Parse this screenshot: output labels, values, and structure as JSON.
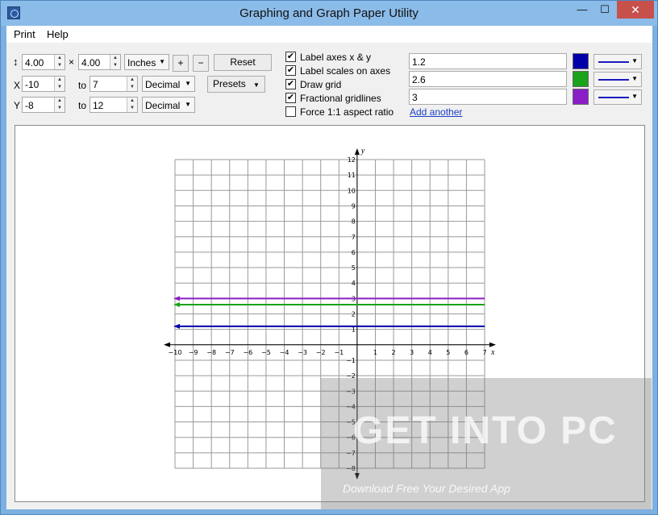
{
  "window": {
    "title": "Graphing and Graph Paper Utility",
    "min_glyph": "—",
    "max_glyph": "☐",
    "close_glyph": "✕"
  },
  "menu": {
    "print": "Print",
    "help": "Help"
  },
  "size": {
    "height_icon_glyph": "↕",
    "width": "4.00",
    "times": "×",
    "height": "4.00",
    "unit": "Inches",
    "plus": "+",
    "minus": "−",
    "reset": "Reset"
  },
  "x_range": {
    "label": "X",
    "from": "-10",
    "to_label": "to",
    "to": "7",
    "format": "Decimal"
  },
  "y_range": {
    "label": "Y",
    "from": "-8",
    "to_label": "to",
    "to": "12",
    "format": "Decimal"
  },
  "presets": "Presets",
  "options": {
    "label_axes": {
      "text": "Label axes x & y",
      "checked": true
    },
    "label_scales": {
      "text": "Label scales on axes",
      "checked": true
    },
    "draw_grid": {
      "text": "Draw grid",
      "checked": true
    },
    "fractional": {
      "text": "Fractional gridlines",
      "checked": true
    },
    "aspect": {
      "text": "Force 1:1 aspect ratio",
      "checked": false
    }
  },
  "functions": [
    {
      "expr": "1.2",
      "color": "#0000a8"
    },
    {
      "expr": "2.6",
      "color": "#1aa31a"
    },
    {
      "expr": "3",
      "color": "#8a1fc7"
    }
  ],
  "add_another": "Add another",
  "chart_data": {
    "type": "line",
    "xlim": [
      -10,
      7
    ],
    "ylim": [
      -8,
      12
    ],
    "xlabel": "x",
    "ylabel": "y",
    "grid": true,
    "x_ticks": [
      -10,
      -9,
      -8,
      -7,
      -6,
      -5,
      -4,
      -3,
      -2,
      -1,
      1,
      2,
      3,
      4,
      5,
      6,
      7
    ],
    "y_ticks": [
      -8,
      -7,
      -6,
      -5,
      -4,
      -3,
      -2,
      -1,
      1,
      2,
      3,
      4,
      5,
      6,
      7,
      8,
      9,
      10,
      11,
      12
    ],
    "series": [
      {
        "y_constant": 1.2,
        "color": "#0000a8"
      },
      {
        "y_constant": 2.6,
        "color": "#1aa31a"
      },
      {
        "y_constant": 3,
        "color": "#8a1fc7"
      }
    ]
  },
  "watermark": {
    "title": "GET INTO PC",
    "subtitle": "Download Free Your Desired App"
  }
}
